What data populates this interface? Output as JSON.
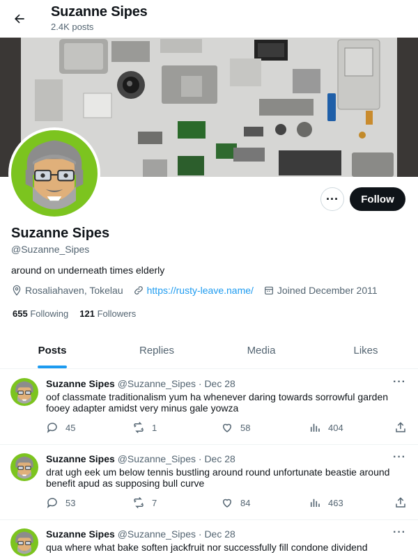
{
  "header": {
    "name": "Suzanne Sipes",
    "post_count": "2.4K posts"
  },
  "profile": {
    "name": "Suzanne Sipes",
    "handle": "@Suzanne_Sipes",
    "bio": "around on underneath times elderly",
    "location": "Rosaliahaven, Tokelau",
    "website": "https://rusty-leave.name/",
    "joined": "Joined December 2011",
    "following_count": "655",
    "following_label": "Following",
    "followers_count": "121",
    "followers_label": "Followers"
  },
  "buttons": {
    "more": "···",
    "follow": "Follow"
  },
  "tabs": [
    {
      "label": "Posts"
    },
    {
      "label": "Replies"
    },
    {
      "label": "Media"
    },
    {
      "label": "Likes"
    }
  ],
  "posts": [
    {
      "author": "Suzanne Sipes",
      "handle": "@Suzanne_Sipes",
      "date": "· Dec 28",
      "text": "oof classmate traditionalism yum ha whenever daring towards sorrowful garden fooey adapter amidst very minus gale yowza",
      "replies": "45",
      "reposts": "1",
      "likes": "58",
      "views": "404"
    },
    {
      "author": "Suzanne Sipes",
      "handle": "@Suzanne_Sipes",
      "date": "· Dec 28",
      "text": "drat ugh eek um below tennis bustling around round unfortunate beastie around benefit apud as supposing bull curve",
      "replies": "53",
      "reposts": "7",
      "likes": "84",
      "views": "463"
    },
    {
      "author": "Suzanne Sipes",
      "handle": "@Suzanne_Sipes",
      "date": "· Dec 28",
      "text": "qua where what bake soften jackfruit nor successfully fill condone dividend",
      "replies": "",
      "reposts": "",
      "likes": "",
      "views": ""
    }
  ],
  "colors": {
    "accent": "#1d9bf0",
    "follow_bg": "#0f1419",
    "muted": "#536471",
    "avatar_bg": "#7cc41f"
  },
  "icons": [
    "back-arrow-icon",
    "location-icon",
    "link-icon",
    "calendar-icon",
    "reply-icon",
    "repost-icon",
    "like-icon",
    "views-icon",
    "share-icon",
    "more-icon"
  ]
}
